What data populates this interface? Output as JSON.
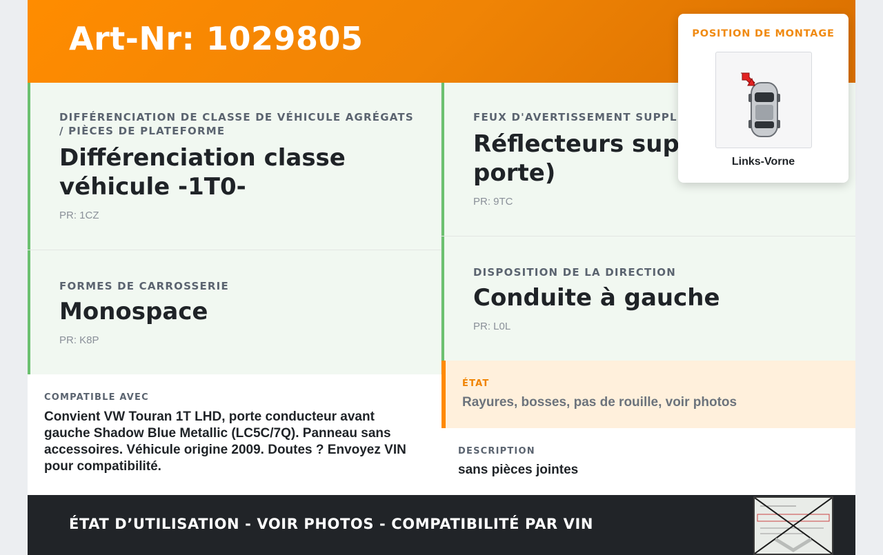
{
  "header": {
    "article_number": "Art-Nr: 1029805"
  },
  "cells": [
    {
      "label": "DIFFÉRENCIATION DE CLASSE DE VÉHICULE AGRÉGATS / PIÈCES DE PLATEFORME",
      "value": "Différenciation classe véhicule -1T0-",
      "pr": "PR: 1CZ"
    },
    {
      "label": "FEUX D'AVERTISSEMENT SUPPLÉM",
      "value": "Réflecteurs supp porte)",
      "pr": "PR: 9TC"
    },
    {
      "label": "FORMES DE CARROSSERIE",
      "value": "Monospace",
      "pr": "PR: K8P"
    },
    {
      "label": "DISPOSITION DE LA DIRECTION",
      "value": "Conduite à gauche",
      "pr": "PR: L0L"
    }
  ],
  "compatible": {
    "label": "COMPATIBLE AVEC",
    "text": "Convient VW Touran 1T LHD, porte conducteur avant gauche Shadow Blue Metallic (LC5C/7Q). Panneau sans accessoires. Véhicule origine 2009. Doutes ? Envoyez VIN pour compatibilité."
  },
  "state": {
    "label": "ÉTAT",
    "text": "Rayures, bosses, pas de rouille, voir photos"
  },
  "description": {
    "label": "DESCRIPTION",
    "text": "sans pièces jointes"
  },
  "footer": {
    "text": "ÉTAT D’UTILISATION - VOIR PHOTOS - COMPATIBILITÉ PAR VIN"
  },
  "mount_popup": {
    "title": "POSITION DE MONTAGE",
    "caption": "Links-Vorne"
  },
  "colors": {
    "accent": "#ff8c00",
    "green_bar": "#6cc070",
    "footer_bg": "#212428"
  }
}
